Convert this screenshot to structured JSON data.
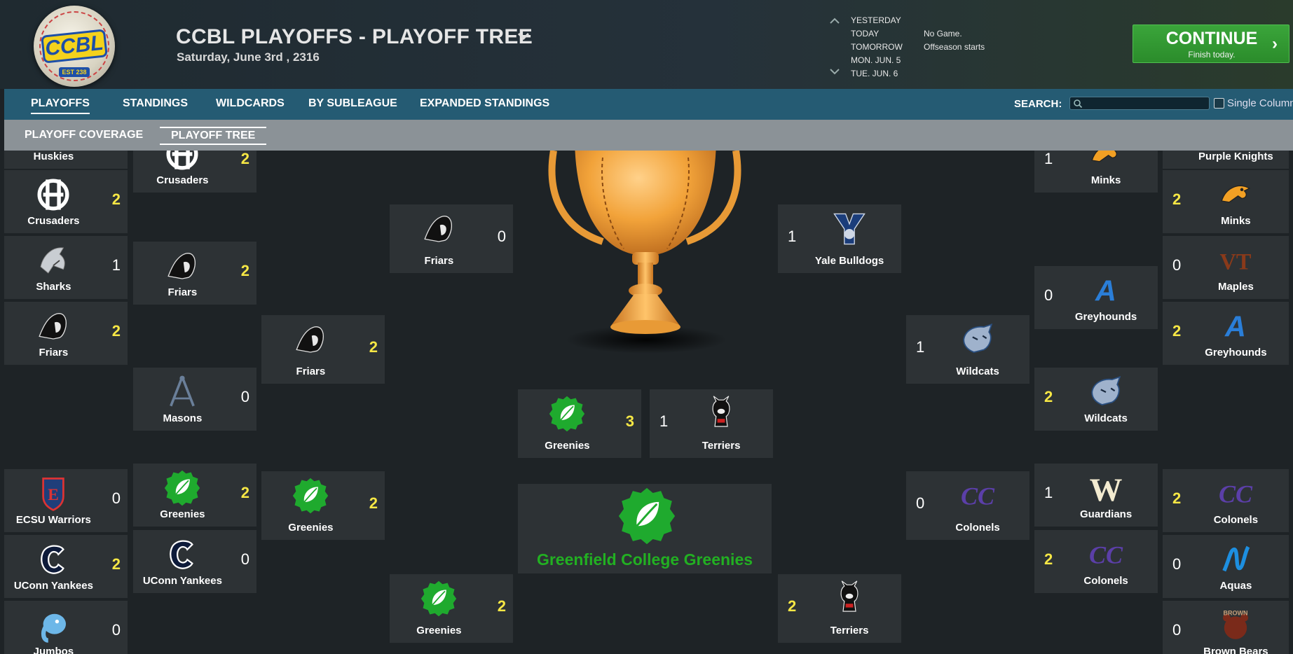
{
  "header": {
    "title": "CCBL PLAYOFFS - PLAYOFF TREE",
    "date": "Saturday, June 3rd , 2316",
    "logo_text": "CCBL",
    "logo_est": "EST 238"
  },
  "schedule": [
    {
      "day": "YESTERDAY",
      "value": ""
    },
    {
      "day": "TODAY",
      "value": "No Game."
    },
    {
      "day": "TOMORROW",
      "value": "Offseason starts"
    },
    {
      "day": "MON. JUN. 5",
      "value": ""
    },
    {
      "day": "TUE. JUN. 6",
      "value": ""
    }
  ],
  "continue_button": {
    "label": "CONTINUE",
    "sub": "Finish today."
  },
  "nav": {
    "tabs": [
      "PLAYOFFS",
      "STANDINGS",
      "WILDCARDS",
      "BY SUBLEAGUE",
      "EXPANDED STANDINGS"
    ],
    "active": "PLAYOFFS",
    "search_label": "SEARCH:",
    "search_value": "",
    "single_column_label": "Single Column"
  },
  "subnav": {
    "tabs": [
      "PLAYOFF COVERAGE",
      "PLAYOFF TREE"
    ],
    "active": "PLAYOFF TREE"
  },
  "bracket": {
    "col1": [
      {
        "name": "Huskies",
        "score": ""
      },
      {
        "name": "Crusaders",
        "score": "2",
        "win": true,
        "icon": "crusaders"
      },
      {
        "name": "Sharks",
        "score": "1",
        "win": false,
        "icon": "sharks"
      },
      {
        "name": "Friars",
        "score": "2",
        "win": true,
        "icon": "friars"
      },
      {
        "name": "ECSU Warriors",
        "score": "0",
        "win": false,
        "icon": "ecsu"
      },
      {
        "name": "UConn Yankees",
        "score": "2",
        "win": true,
        "icon": "uconn"
      },
      {
        "name": "Jumbos",
        "score": "0",
        "win": false,
        "icon": "jumbos"
      }
    ],
    "col2": [
      {
        "name": "Crusaders",
        "score": "2",
        "win": true,
        "icon": "crusaders"
      },
      {
        "name": "Friars",
        "score": "2",
        "win": true,
        "icon": "friars"
      },
      {
        "name": "Masons",
        "score": "0",
        "win": false,
        "icon": "masons"
      },
      {
        "name": "Greenies",
        "score": "2",
        "win": true,
        "icon": "greenies"
      },
      {
        "name": "UConn Yankees",
        "score": "0",
        "win": false,
        "icon": "uconn"
      }
    ],
    "col3": [
      {
        "name": "Friars",
        "score": "2",
        "win": true,
        "icon": "friars"
      },
      {
        "name": "Greenies",
        "score": "2",
        "win": true,
        "icon": "greenies"
      }
    ],
    "col4": [
      {
        "name": "Friars",
        "score": "0",
        "win": false,
        "icon": "friars"
      },
      {
        "name": "Greenies",
        "score": "2",
        "win": true,
        "icon": "greenies"
      }
    ],
    "final_left": {
      "name": "Greenies",
      "score": "3",
      "win": true,
      "icon": "greenies"
    },
    "final_right": {
      "name": "Terriers",
      "score": "1",
      "win": false,
      "icon": "terriers"
    },
    "champion": {
      "name": "Greenfield College Greenies"
    },
    "col6": [
      {
        "name": "Yale Bulldogs",
        "score": "1",
        "win": false,
        "icon": "yale"
      },
      {
        "name": "Terriers",
        "score": "2",
        "win": true,
        "icon": "terriers"
      }
    ],
    "col7": [
      {
        "name": "Wildcats",
        "score": "1",
        "win": false,
        "icon": "wildcats"
      },
      {
        "name": "Colonels",
        "score": "0",
        "win": false,
        "icon": "colonels"
      }
    ],
    "col8": [
      {
        "name": "Minks",
        "score": "1",
        "win": false,
        "icon": "minks"
      },
      {
        "name": "Greyhounds",
        "score": "0",
        "win": false,
        "icon": "greyhounds"
      },
      {
        "name": "Wildcats",
        "score": "2",
        "win": true,
        "icon": "wildcats"
      },
      {
        "name": "Guardians",
        "score": "1",
        "win": false,
        "icon": "guardians"
      },
      {
        "name": "Colonels",
        "score": "2",
        "win": true,
        "icon": "colonels"
      }
    ],
    "col9": [
      {
        "name": "Purple Knights",
        "score": ""
      },
      {
        "name": "Minks",
        "score": "2",
        "win": true,
        "icon": "minks"
      },
      {
        "name": "Maples",
        "score": "0",
        "win": false,
        "icon": "maples"
      },
      {
        "name": "Greyhounds",
        "score": "2",
        "win": true,
        "icon": "greyhounds"
      },
      {
        "name": "Colonels",
        "score": "2",
        "win": true,
        "icon": "colonels"
      },
      {
        "name": "Aquas",
        "score": "0",
        "win": false,
        "icon": "aquas"
      },
      {
        "name": "Brown Bears",
        "score": "0",
        "win": false,
        "icon": "brown"
      }
    ]
  },
  "colors": {
    "nav_bg": "#255b73",
    "subnav_bg": "#8b9297",
    "continue_green": "#2f9a2f",
    "win_yellow": "#f6e745",
    "champion_green": "#22b022"
  }
}
